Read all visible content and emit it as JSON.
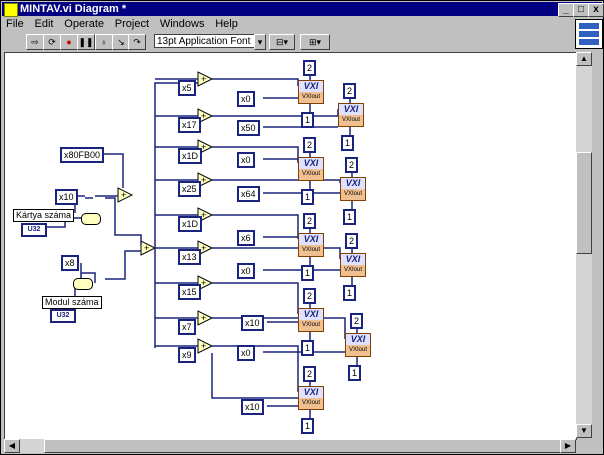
{
  "window": {
    "title": "MINTAV.vi Diagram *"
  },
  "title_buttons": {
    "min": "_",
    "max": "□",
    "close": "x"
  },
  "menu": {
    "items": [
      "File",
      "Edit",
      "Operate",
      "Project",
      "Windows",
      "Help"
    ]
  },
  "toolbar": {
    "font": "13pt Application Font"
  },
  "labels": {
    "kartya": "Kártya száma",
    "modul": "Modul száma",
    "u32": "U32"
  },
  "constants": {
    "hex": "x80FB00",
    "x10": "x10",
    "x8": "x8",
    "inputs": [
      "x5",
      "x17",
      "x1D",
      "x25",
      "x1D",
      "x13",
      "x15",
      "x7",
      "x9"
    ],
    "data": [
      "x0",
      "x50",
      "x0",
      "x64",
      "x6",
      "x0",
      "x10",
      "x0",
      "x10"
    ],
    "twos": [
      "2",
      "2",
      "2",
      "2",
      "2",
      "2",
      "2",
      "2",
      "2"
    ],
    "ones": [
      "1",
      "1",
      "1",
      "1",
      "1",
      "1",
      "1",
      "1",
      "1"
    ]
  },
  "vi_label": "VXI",
  "vi_sub": "VXIout"
}
